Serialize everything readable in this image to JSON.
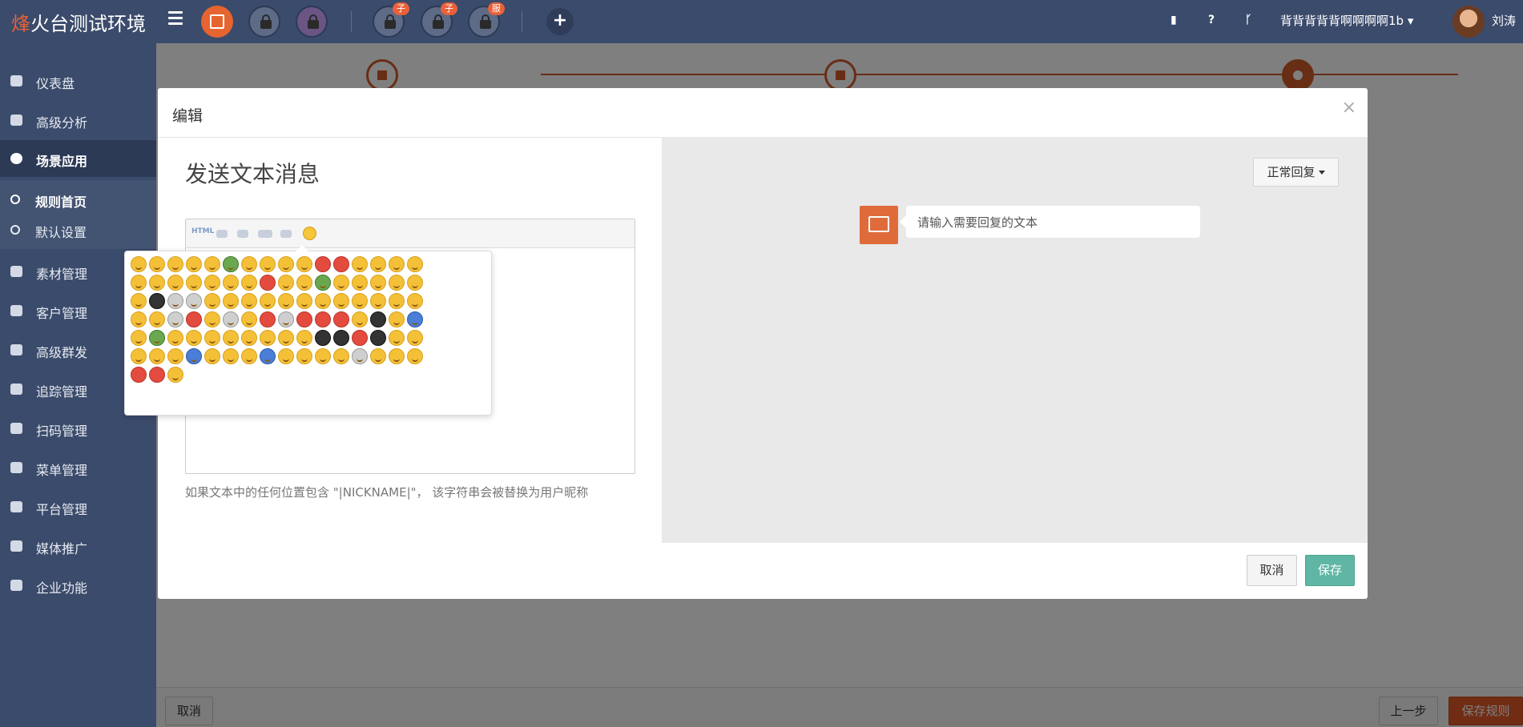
{
  "app": {
    "title_prefix": "烽",
    "title_rest": "火台测试环境"
  },
  "header": {
    "badges": [
      "子",
      "子",
      "服"
    ],
    "account_label": "背背背背背啊啊啊啊1b",
    "user_name": "刘涛"
  },
  "sidebar": {
    "items": [
      {
        "label": "仪表盘"
      },
      {
        "label": "高级分析"
      },
      {
        "label": "场景应用"
      },
      {
        "label": "素材管理"
      },
      {
        "label": "客户管理"
      },
      {
        "label": "高级群发"
      },
      {
        "label": "追踪管理"
      },
      {
        "label": "扫码管理"
      },
      {
        "label": "菜单管理"
      },
      {
        "label": "平台管理"
      },
      {
        "label": "媒体推广"
      },
      {
        "label": "企业功能"
      }
    ],
    "subitems": [
      {
        "label": "规则首页"
      },
      {
        "label": "默认设置"
      }
    ]
  },
  "background_page": {
    "cancel_label": "取消",
    "prev_label": "上一步",
    "save_rule_label": "保存规则"
  },
  "modal": {
    "title": "编辑",
    "close": "×",
    "heading": "发送文本消息",
    "toolbar_html": "HTML",
    "hint": "如果文本中的任何位置包含 \"|NICKNAME|\"， 该字符串会被替换为用户昵称",
    "reply_type": "正常回复",
    "preview_placeholder": "请输入需要回复的文本",
    "cancel_label": "取消",
    "save_label": "保存"
  },
  "colors": {
    "topbar": "#3b4b6b",
    "accent": "#e05a28",
    "save_button": "#5fb6a4"
  }
}
